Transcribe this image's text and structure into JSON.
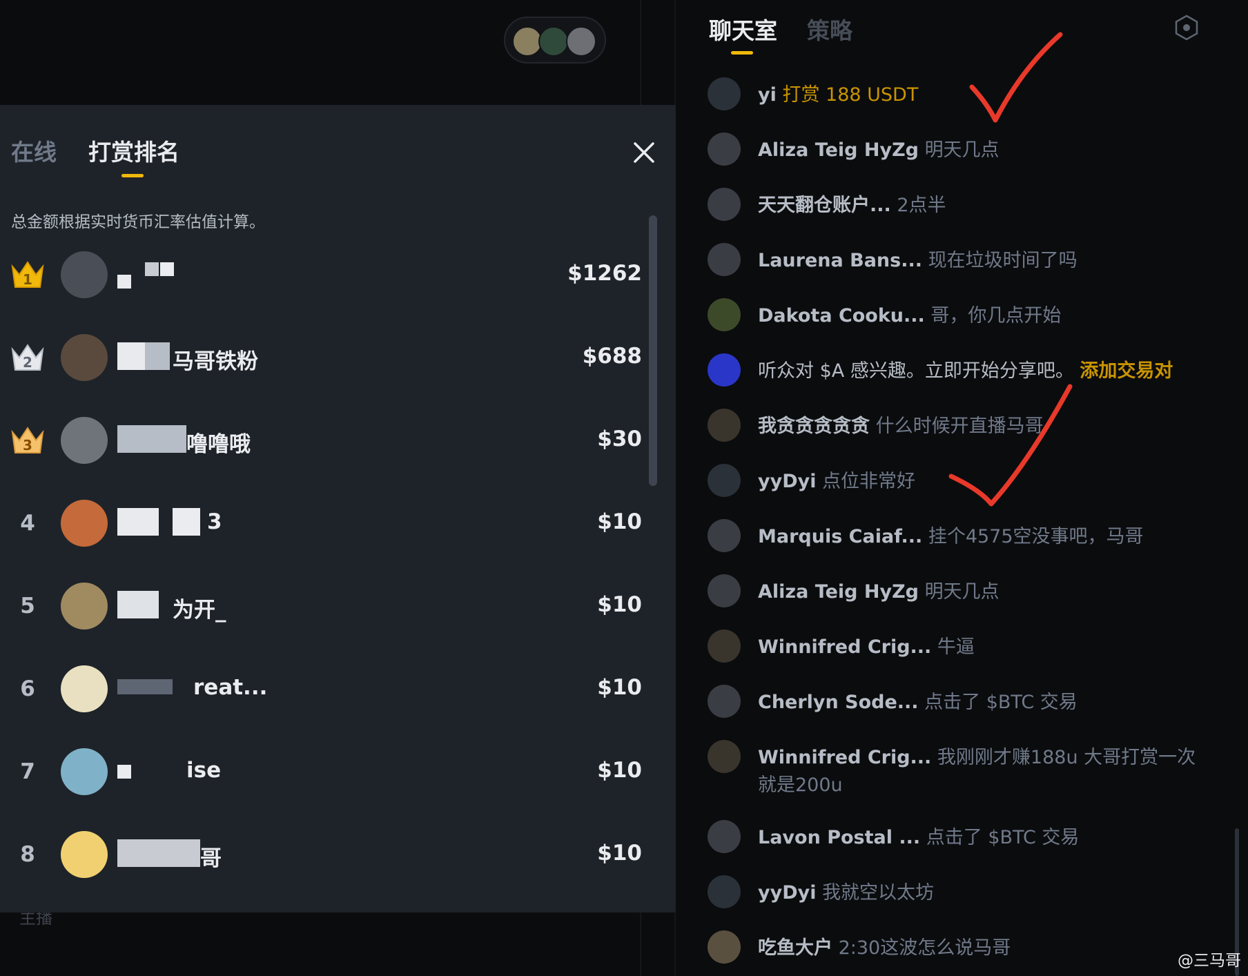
{
  "ranking_panel": {
    "tabs": [
      "在线",
      "打赏排名"
    ],
    "note": "总金额根据实时货币汇率估值计算。",
    "rows": [
      {
        "rank": "1",
        "name": "",
        "amount": "$1262"
      },
      {
        "rank": "2",
        "name": "马哥铁粉",
        "amount": "$688"
      },
      {
        "rank": "3",
        "name": "噜噜哦",
        "amount": "$30"
      },
      {
        "rank": "4",
        "name": "3",
        "amount": "$10"
      },
      {
        "rank": "5",
        "name": "为开_",
        "amount": "$10"
      },
      {
        "rank": "6",
        "name": "reat...",
        "amount": "$10"
      },
      {
        "rank": "7",
        "name": "ise",
        "amount": "$10"
      },
      {
        "rank": "8",
        "name": "哥",
        "amount": "$10"
      }
    ],
    "below_label": "主播"
  },
  "chat": {
    "tabs": [
      "聊天室",
      "策略"
    ],
    "messages": [
      {
        "user": "yi",
        "text": "打赏 188 USDT",
        "style": "gold"
      },
      {
        "user": "Aliza Teig HyZg",
        "text": "明天几点"
      },
      {
        "user": "天天翻仓账户...",
        "text": "2点半"
      },
      {
        "user": "Laurena Bans...",
        "text": "现在垃圾时间了吗"
      },
      {
        "user": "Dakota Cooku...",
        "text": "哥，你几点开始"
      },
      {
        "user": "听众对 $A 感兴趣。立即开始分享吧。",
        "text": "添加交易对",
        "style": "system"
      },
      {
        "user": "我贪贪贪贪贪",
        "text": "什么时候开直播马哥"
      },
      {
        "user": "yyDyi",
        "text": "点位非常好"
      },
      {
        "user": "Marquis Caiaf...",
        "text": "挂个4575空没事吧，马哥"
      },
      {
        "user": "Aliza Teig HyZg",
        "text": "明天几点"
      },
      {
        "user": "Winnifred Crig...",
        "text": "牛逼"
      },
      {
        "user": "Cherlyn Sode...",
        "text": "点击了 $BTC 交易"
      },
      {
        "user": "Winnifred Crig...",
        "text": "我刚刚才赚188u 大哥打赏一次就是200u"
      },
      {
        "user": "Lavon Postal ...",
        "text": "点击了 $BTC 交易"
      },
      {
        "user": "yyDyi",
        "text": "我就空以太坊"
      },
      {
        "user": "吃鱼大户",
        "text": "2:30这波怎么说马哥"
      }
    ]
  },
  "watermark": "@三马哥",
  "colors": {
    "accent": "#f0b90b",
    "gold_text": "#c99400",
    "panel_bg": "#1e2329",
    "check_red": "#e8392a"
  }
}
